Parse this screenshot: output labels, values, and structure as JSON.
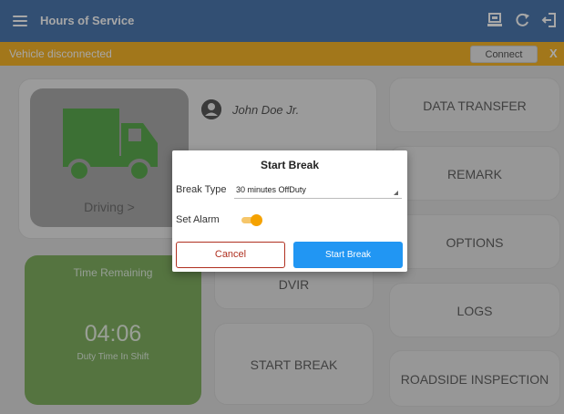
{
  "topbar": {
    "title": "Hours of Service",
    "icons": [
      "menu-icon",
      "printer-icon",
      "refresh-icon",
      "logout-icon"
    ]
  },
  "banner": {
    "message": "Vehicle disconnected",
    "connect_label": "Connect",
    "close_label": "X"
  },
  "status": {
    "driving_label": "Driving >",
    "user_name": "John Doe Jr."
  },
  "time": {
    "title": "Time Remaining",
    "value": "04:06",
    "caption": "Duty Time In Shift"
  },
  "actions": {
    "dvir": "DVIR",
    "start_break": "START BREAK"
  },
  "side_buttons": [
    "DATA TRANSFER",
    "REMARK",
    "OPTIONS",
    "LOGS",
    "ROADSIDE INSPECTION"
  ],
  "dialog": {
    "title": "Start Break",
    "break_type_label": "Break Type",
    "break_type_value": "30 minutes OffDuty",
    "alarm_label": "Set Alarm",
    "alarm_on": true,
    "cancel_label": "Cancel",
    "start_label": "Start Break"
  },
  "colors": {
    "header": "#2b5fa0",
    "banner": "#f6a800",
    "time_card": "#6aa344",
    "primary_button": "#2196f3",
    "cancel": "#b03020"
  }
}
